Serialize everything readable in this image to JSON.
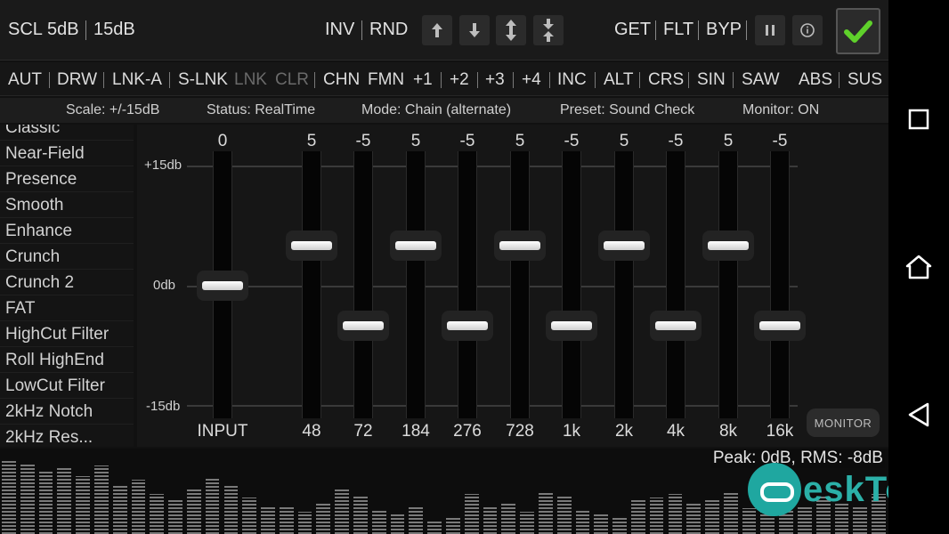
{
  "topbar": {
    "scl": "SCL",
    "scale_5": "5dB",
    "scale_15": "15dB",
    "inv": "INV",
    "rnd": "RND",
    "get": "GET",
    "flt": "FLT",
    "byp": "BYP"
  },
  "funcbar": {
    "items": [
      "AUT",
      "DRW",
      "LNK-A",
      "S-LNK",
      "LNK",
      "CLR",
      "CHN",
      "FMN",
      "+1",
      "+2",
      "+3",
      "+4",
      "INC",
      "ALT",
      "CRS",
      "SIN",
      "SAW",
      "ABS",
      "SUS"
    ]
  },
  "status": {
    "scale": "Scale: +/-15dB",
    "status": "Status: RealTime",
    "mode": "Mode: Chain (alternate)",
    "preset": "Preset: Sound Check",
    "monitor": "Monitor: ON"
  },
  "presets": [
    "Classic",
    "Near-Field",
    "Presence",
    "Smooth",
    "Enhance",
    "Crunch",
    "Crunch 2",
    "FAT",
    "HighCut Filter",
    "Roll HighEnd",
    "LowCut Filter",
    "2kHz Notch",
    "2kHz Res..."
  ],
  "eq": {
    "db_top": "+15db",
    "db_mid": "0db",
    "db_bottom": "-15db",
    "range_db": [
      -15,
      15
    ],
    "bands": [
      {
        "freq": "INPUT",
        "value": "0",
        "db": 0
      },
      {
        "freq": "48",
        "value": "5",
        "db": 5
      },
      {
        "freq": "72",
        "value": "-5",
        "db": -5
      },
      {
        "freq": "184",
        "value": "5",
        "db": 5
      },
      {
        "freq": "276",
        "value": "-5",
        "db": -5
      },
      {
        "freq": "728",
        "value": "5",
        "db": 5
      },
      {
        "freq": "1k",
        "value": "-5",
        "db": -5
      },
      {
        "freq": "2k",
        "value": "5",
        "db": 5
      },
      {
        "freq": "4k",
        "value": "-5",
        "db": -5
      },
      {
        "freq": "8k",
        "value": "5",
        "db": 5
      },
      {
        "freq": "16k",
        "value": "-5",
        "db": -5
      }
    ],
    "monitor_label": "MONITOR"
  },
  "spectrum": {
    "peak": "Peak: 0dB, RMS: -8dB",
    "levels": [
      0.92,
      0.88,
      0.78,
      0.82,
      0.72,
      0.85,
      0.6,
      0.68,
      0.5,
      0.42,
      0.56,
      0.7,
      0.62,
      0.46,
      0.36,
      0.34,
      0.28,
      0.4,
      0.58,
      0.48,
      0.3,
      0.26,
      0.34,
      0.18,
      0.22,
      0.5,
      0.36,
      0.4,
      0.28,
      0.52,
      0.48,
      0.3,
      0.24,
      0.2,
      0.42,
      0.46,
      0.5,
      0.38,
      0.44,
      0.52,
      0.32,
      0.4,
      0.3,
      0.36,
      0.48,
      0.4,
      0.34,
      0.5
    ]
  },
  "watermark": {
    "text": "eskTop"
  },
  "colors": {
    "accent_check": "#5fd12b",
    "watermark": "#2bb0a8"
  }
}
